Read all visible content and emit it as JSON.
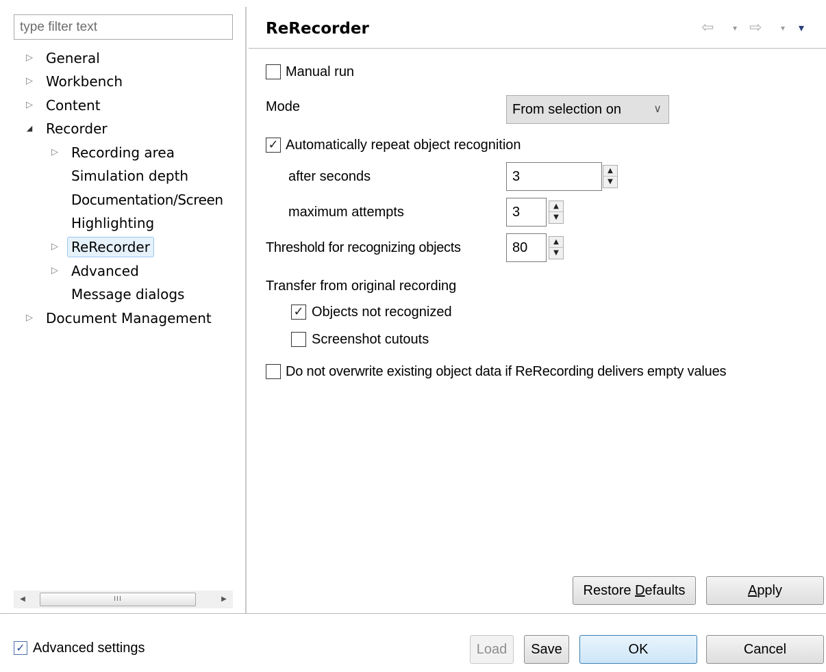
{
  "filter": {
    "placeholder": "type filter text"
  },
  "tree": {
    "items": [
      {
        "label": "General",
        "expander": "▷"
      },
      {
        "label": "Workbench",
        "expander": "▷"
      },
      {
        "label": "Content",
        "expander": "▷"
      },
      {
        "label": "Recorder",
        "expander": "◢"
      },
      {
        "label": "Recording area",
        "expander": "▷"
      },
      {
        "label": "Simulation depth"
      },
      {
        "label": "Documentation/Screen"
      },
      {
        "label": "Highlighting"
      },
      {
        "label": "ReRecorder",
        "expander": "▷",
        "selected": true
      },
      {
        "label": "Advanced",
        "expander": "▷"
      },
      {
        "label": "Message dialogs"
      },
      {
        "label": "Document Management",
        "expander": "▷"
      }
    ]
  },
  "scrollbar": {
    "thumb_grip": "III"
  },
  "page": {
    "title": "ReRecorder",
    "nav": {
      "back": "⇦",
      "forward": "⇨",
      "dropdown": "▾",
      "menu": "▾"
    }
  },
  "form": {
    "manual_run": {
      "label": "Manual run",
      "checked": false
    },
    "mode": {
      "label": "Mode",
      "value": "From selection on",
      "chevron": "∨"
    },
    "auto_repeat": {
      "label": "Automatically repeat object recognition",
      "checked": true
    },
    "after_seconds": {
      "label": "after seconds",
      "value": "3"
    },
    "max_attempts": {
      "label": "maximum attempts",
      "value": "3"
    },
    "threshold": {
      "label": "Threshold for recognizing objects",
      "value": "80"
    },
    "transfer": {
      "label": "Transfer from original recording",
      "objects_not_recognized": {
        "label": "Objects not recognized",
        "checked": true
      },
      "screenshot_cutouts": {
        "label": "Screenshot cutouts",
        "checked": false
      }
    },
    "no_overwrite": {
      "label": "Do not overwrite existing object data if ReRecording delivers empty values",
      "checked": false
    }
  },
  "buttons": {
    "restore_defaults": {
      "pre": "Restore ",
      "mnemonic": "D",
      "post": "efaults"
    },
    "apply": {
      "mnemonic": "A",
      "post": "pply"
    },
    "load": "Load",
    "save": "Save",
    "ok": "OK",
    "cancel": "Cancel"
  },
  "footer": {
    "advanced_settings": {
      "label": "Advanced settings",
      "checked": true
    }
  },
  "icons": {
    "check": "✓",
    "spin_up": "▲",
    "spin_down": "▼",
    "scroll_left": "◀",
    "scroll_right": "▶"
  }
}
